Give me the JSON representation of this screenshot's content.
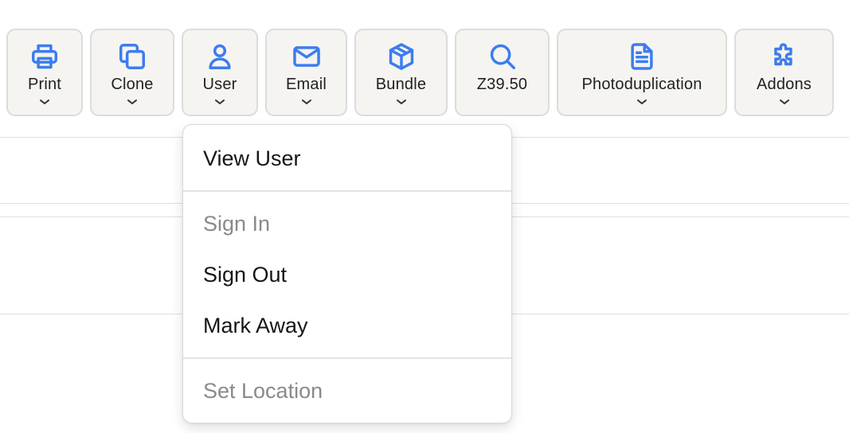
{
  "toolbar": {
    "buttons": [
      {
        "key": "print",
        "label": "Print",
        "icon": "printer-icon",
        "has_dropdown": true
      },
      {
        "key": "clone",
        "label": "Clone",
        "icon": "copy-icon",
        "has_dropdown": true
      },
      {
        "key": "user",
        "label": "User",
        "icon": "user-icon",
        "has_dropdown": true
      },
      {
        "key": "email",
        "label": "Email",
        "icon": "envelope-icon",
        "has_dropdown": true
      },
      {
        "key": "bundle",
        "label": "Bundle",
        "icon": "cube-icon",
        "has_dropdown": true
      },
      {
        "key": "z3950",
        "label": "Z39.50",
        "icon": "search-icon",
        "has_dropdown": false
      },
      {
        "key": "photoduplication",
        "label": "Photoduplication",
        "icon": "document-icon",
        "has_dropdown": true
      },
      {
        "key": "addons",
        "label": "Addons",
        "icon": "puzzle-icon",
        "has_dropdown": true
      }
    ]
  },
  "user_menu": {
    "open": true,
    "items": [
      {
        "label": "View User",
        "enabled": true
      },
      {
        "label": "Sign In",
        "enabled": false
      },
      {
        "label": "Sign Out",
        "enabled": true
      },
      {
        "label": "Mark Away",
        "enabled": true
      },
      {
        "label": "Set Location",
        "enabled": false
      }
    ]
  },
  "colors": {
    "icon_accent": "#3d7cf0",
    "button_bg": "#f5f4f0",
    "disabled_text": "#8a8a8a"
  }
}
